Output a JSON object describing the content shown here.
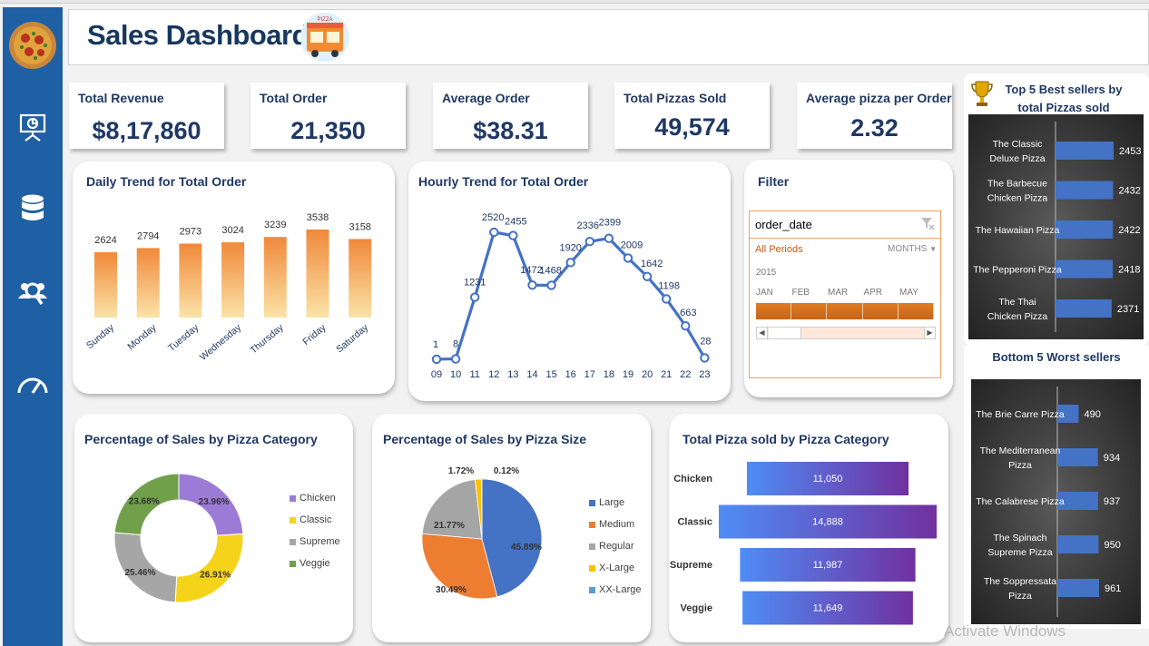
{
  "header": {
    "title": "Sales Dashboard",
    "logo_text": "PIZZA"
  },
  "sidebar": {
    "items": [
      {
        "name": "pizza-logo"
      },
      {
        "name": "presentation-icon"
      },
      {
        "name": "database-icon"
      },
      {
        "name": "users-search-icon"
      },
      {
        "name": "speedometer-icon"
      }
    ]
  },
  "kpis": [
    {
      "label": "Total Revenue",
      "value": "$8,17,860"
    },
    {
      "label": "Total Order",
      "value": "21,350"
    },
    {
      "label": "Average Order",
      "value": "$38.31"
    },
    {
      "label": "Total Pizzas Sold",
      "value": "49,574"
    },
    {
      "label": "Average pizza per Order",
      "value": "2.32"
    }
  ],
  "colors": {
    "accent": "#1f5fa3",
    "orange": "#f4a460",
    "blue": "#4472c4",
    "purple": "#7030a0"
  },
  "chart_data": [
    {
      "type": "bar",
      "title": "Daily Trend for Total Order",
      "categories": [
        "Sunday",
        "Monday",
        "Tuesday",
        "Wednesday",
        "Thursday",
        "Friday",
        "Saturday"
      ],
      "values": [
        2624,
        2794,
        2973,
        3024,
        3239,
        3538,
        3158
      ]
    },
    {
      "type": "line",
      "title": "Hourly Trend for Total Order",
      "x": [
        "09",
        "10",
        "11",
        "12",
        "13",
        "14",
        "15",
        "16",
        "17",
        "18",
        "19",
        "20",
        "21",
        "22",
        "23"
      ],
      "values": [
        1,
        8,
        1231,
        2520,
        2455,
        1472,
        1468,
        1920,
        2336,
        2399,
        2009,
        1642,
        1198,
        663,
        28
      ]
    },
    {
      "type": "pie",
      "title": "Percentage of Sales by Pizza Category",
      "categories": [
        "Chicken",
        "Classic",
        "Supreme",
        "Veggie"
      ],
      "values": [
        23.96,
        26.91,
        25.46,
        23.68
      ],
      "labels": [
        "23.96%",
        "26.91%",
        "25.46%",
        "23.68%"
      ],
      "colors": [
        "#9b7bd6",
        "#f5d31a",
        "#a6a6a6",
        "#70a04a"
      ]
    },
    {
      "type": "pie",
      "title": "Percentage of Sales by Pizza Size",
      "categories": [
        "Large",
        "Medium",
        "Regular",
        "X-Large",
        "XX-Large"
      ],
      "values": [
        45.89,
        30.49,
        21.77,
        1.72,
        0.12
      ],
      "labels": [
        "45.89%",
        "30.49%",
        "21.77%",
        "1.72%",
        "0.12%"
      ],
      "colors": [
        "#4472c4",
        "#ed7d31",
        "#a5a5a5",
        "#ffc000",
        "#5b9bd5"
      ]
    },
    {
      "type": "bar",
      "title": "Total Pizza sold by Pizza Category",
      "categories": [
        "Chicken",
        "Classic",
        "Supreme",
        "Veggie"
      ],
      "values": [
        11050,
        14888,
        11987,
        11649
      ],
      "labels": [
        "11,050",
        "14,888",
        "11,987",
        "11,649"
      ]
    },
    {
      "type": "bar",
      "title": "Top 5 Best sellers  by total Pizzas sold",
      "categories": [
        "The Classic Deluxe Pizza",
        "The Barbecue Chicken Pizza",
        "The Hawaiian Pizza",
        "The Pepperoni Pizza",
        "The Thai Chicken Pizza"
      ],
      "values": [
        2453,
        2432,
        2422,
        2418,
        2371
      ]
    },
    {
      "type": "bar",
      "title": "Bottom 5 Worst sellers",
      "categories": [
        "The Brie Carre Pizza",
        "The Mediterranean Pizza",
        "The Calabrese Pizza",
        "The Spinach Supreme Pizza",
        "The Soppressata Pizza"
      ],
      "values": [
        490,
        934,
        937,
        950,
        961
      ]
    }
  ],
  "filter": {
    "title": "Filter",
    "field": "order_date",
    "period_label": "All Periods",
    "unit_label": "MONTHS",
    "year": "2015",
    "months": [
      "JAN",
      "FEB",
      "MAR",
      "APR",
      "MAY"
    ]
  },
  "watermark": "Activate Windows"
}
